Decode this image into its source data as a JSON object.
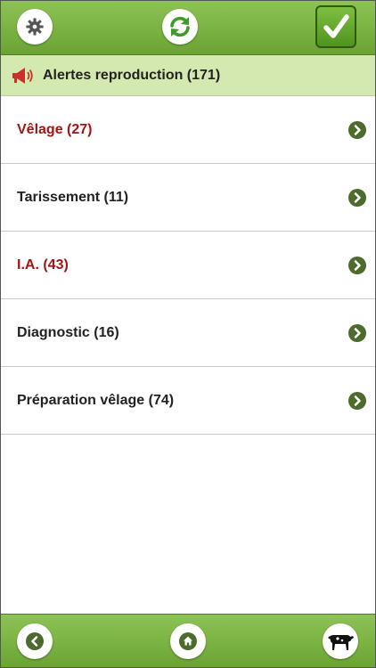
{
  "header": {
    "settings_icon": "gear-icon",
    "refresh_icon": "refresh-icon",
    "validate_icon": "checkmark-icon"
  },
  "section": {
    "icon": "megaphone-icon",
    "title": "Alertes reproduction (171)"
  },
  "items": [
    {
      "label": "Vêlage (27)",
      "alert": true
    },
    {
      "label": "Tarissement (11)",
      "alert": false
    },
    {
      "label": "I.A. (43)",
      "alert": true
    },
    {
      "label": "Diagnostic (16)",
      "alert": false
    },
    {
      "label": "Préparation vêlage (74)",
      "alert": false
    }
  ],
  "footer": {
    "back_icon": "back-icon",
    "home_icon": "home-icon",
    "cow_icon": "cow-icon"
  },
  "colors": {
    "bar_green": "#7cb444",
    "header_light_green": "#d4e9b0",
    "alert_red": "#a31515",
    "chevron_green": "#4d6b2c"
  }
}
